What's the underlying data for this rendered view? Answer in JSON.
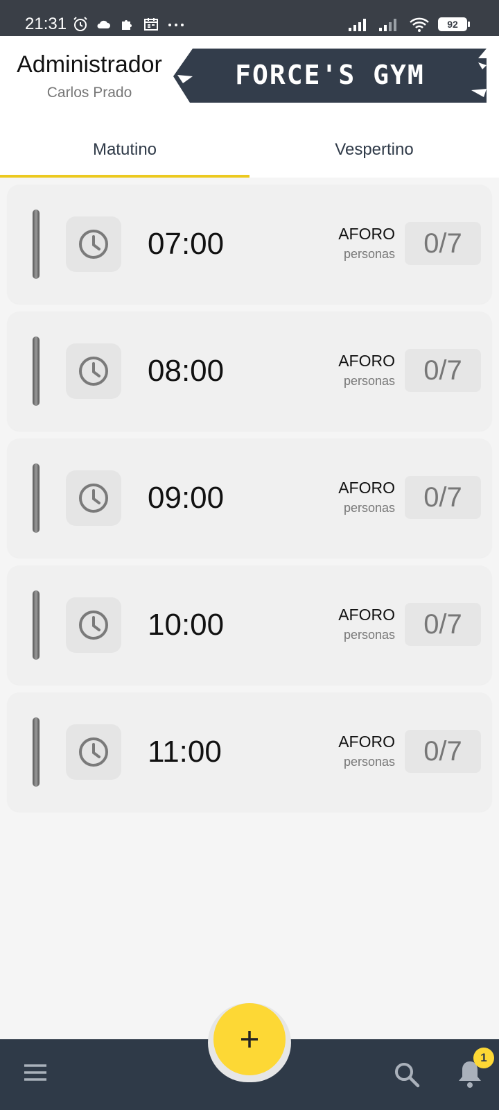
{
  "status_bar": {
    "time": "21:31",
    "left_icons": [
      "alarm-icon",
      "cloud-icon",
      "puzzle-icon",
      "calendar-icon",
      "more-dots-icon"
    ],
    "right_icons": [
      "signal-icon",
      "signal-weak-icon",
      "wifi-icon",
      "battery-icon"
    ],
    "battery_level": "92"
  },
  "header": {
    "role": "Administrador",
    "user_name": "Carlos Prado",
    "logo_text": "FORCE'S GYM"
  },
  "tabs": [
    {
      "label": "Matutino",
      "active": true
    },
    {
      "label": "Vespertino",
      "active": false
    }
  ],
  "slots": [
    {
      "time": "07:00",
      "aforo_label": "AFORO",
      "aforo_sub": "personas",
      "capacity": "0/7"
    },
    {
      "time": "08:00",
      "aforo_label": "AFORO",
      "aforo_sub": "personas",
      "capacity": "0/7"
    },
    {
      "time": "09:00",
      "aforo_label": "AFORO",
      "aforo_sub": "personas",
      "capacity": "0/7"
    },
    {
      "time": "10:00",
      "aforo_label": "AFORO",
      "aforo_sub": "personas",
      "capacity": "0/7"
    },
    {
      "time": "11:00",
      "aforo_label": "AFORO",
      "aforo_sub": "personas",
      "capacity": "0/7"
    }
  ],
  "bottom_nav": {
    "fab_icon": "plus-icon",
    "menu_icon": "menu-icon",
    "search_icon": "search-icon",
    "notifications_icon": "bell-icon",
    "notification_count": "1"
  },
  "colors": {
    "accent": "#fdd835",
    "dark": "#2f3a48",
    "status_bar": "#3a3f47",
    "tab_indicator": "#ecc91f"
  }
}
